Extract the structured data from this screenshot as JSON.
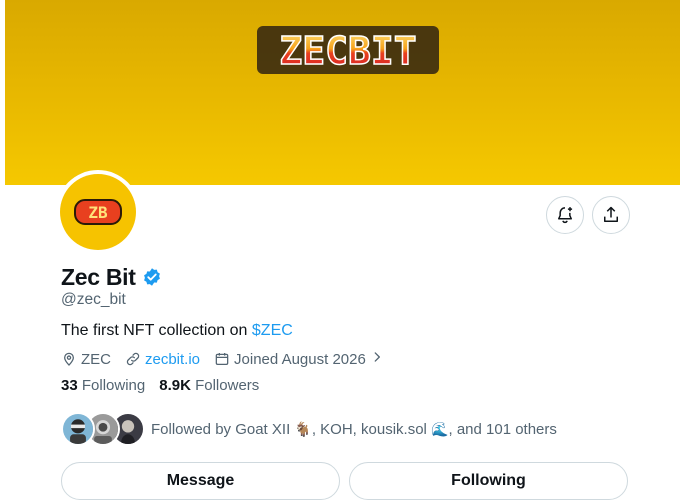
{
  "banner": {
    "logo_text": "ZECBIT"
  },
  "avatar": {
    "logo_text": "ZB"
  },
  "profile": {
    "display_name": "Zec Bit",
    "handle": "@zec_bit",
    "bio_prefix": "The first NFT collection on ",
    "bio_link": "$ZEC",
    "location": "ZEC",
    "website": "zecbit.io",
    "joined": "Joined August 2026"
  },
  "stats": {
    "following_count": "33",
    "following_label": "Following",
    "followers_count": "8.9K",
    "followers_label": "Followers"
  },
  "followed_by": {
    "prefix": "Followed by Goat XII ",
    "emoji1": "🐐",
    "middle": ", KOH, kousik.sol ",
    "emoji2": "🌊",
    "suffix": ", and 101 others"
  },
  "actions": {
    "message_label": "Message",
    "following_label": "Following"
  },
  "icons": {
    "notify": "bell-plus-icon",
    "share": "share-upload-icon",
    "verified": "verified-badge-icon",
    "location": "location-pin-icon",
    "link": "link-icon",
    "calendar": "calendar-icon",
    "chevron": "chevron-right-icon"
  },
  "colors": {
    "banner_top": "#d9a900",
    "banner_bottom": "#f5c800",
    "link_blue": "#1d9bf0",
    "secondary_text": "#536471",
    "verified_blue": "#1d9bf0"
  }
}
